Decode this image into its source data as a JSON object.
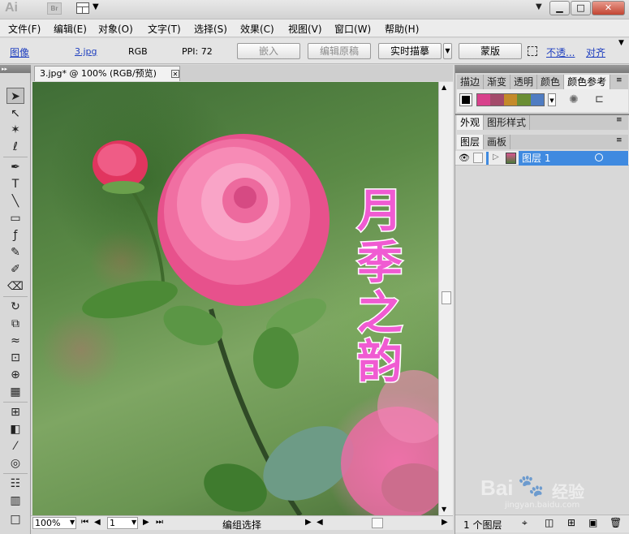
{
  "titlebar": {
    "app_logo": "Ai",
    "bridge_logo": "Br",
    "colors": {
      "close": "#c24532"
    }
  },
  "menu": [
    "文件(F)",
    "编辑(E)",
    "对象(O)",
    "文字(T)",
    "选择(S)",
    "效果(C)",
    "视图(V)",
    "窗口(W)",
    "帮助(H)"
  ],
  "control_bar": {
    "object_type": "图像",
    "file_name": "3.jpg",
    "color_mode": "RGB",
    "ppi": "PPI: 72",
    "embed_label": "嵌入",
    "edit_original_label": "编辑原稿",
    "live_trace_label": "实时描摹",
    "mask_label": "蒙版",
    "opacity_label": "不透...",
    "align_label": "对齐"
  },
  "document": {
    "tab_title": "3.jpg* @ 100% (RGB/预览)",
    "artwork_text": [
      "月",
      "季",
      "之",
      "韵"
    ],
    "text_color": "#f25bd0"
  },
  "statusbar": {
    "zoom": "100%",
    "page": "1",
    "status_text": "编组选择"
  },
  "right_panel": {
    "swatch_tabs": [
      "描边",
      "渐变",
      "透明",
      "颜色",
      "颜色参考"
    ],
    "appearance_tabs": [
      "外观",
      "图形样式"
    ],
    "layer_tabs": [
      "图层",
      "画板"
    ],
    "layers": [
      {
        "name": "图层 1"
      }
    ],
    "layer_count": "1 个图层",
    "harmony_colors": [
      "#d8418c",
      "#a34a6a",
      "#c48a2a",
      "#6a8e34",
      "#4f7cc2"
    ]
  },
  "watermark": {
    "brand": "Bai",
    "brand_suffix": "经验",
    "url": "jingyan.baidu.com"
  }
}
